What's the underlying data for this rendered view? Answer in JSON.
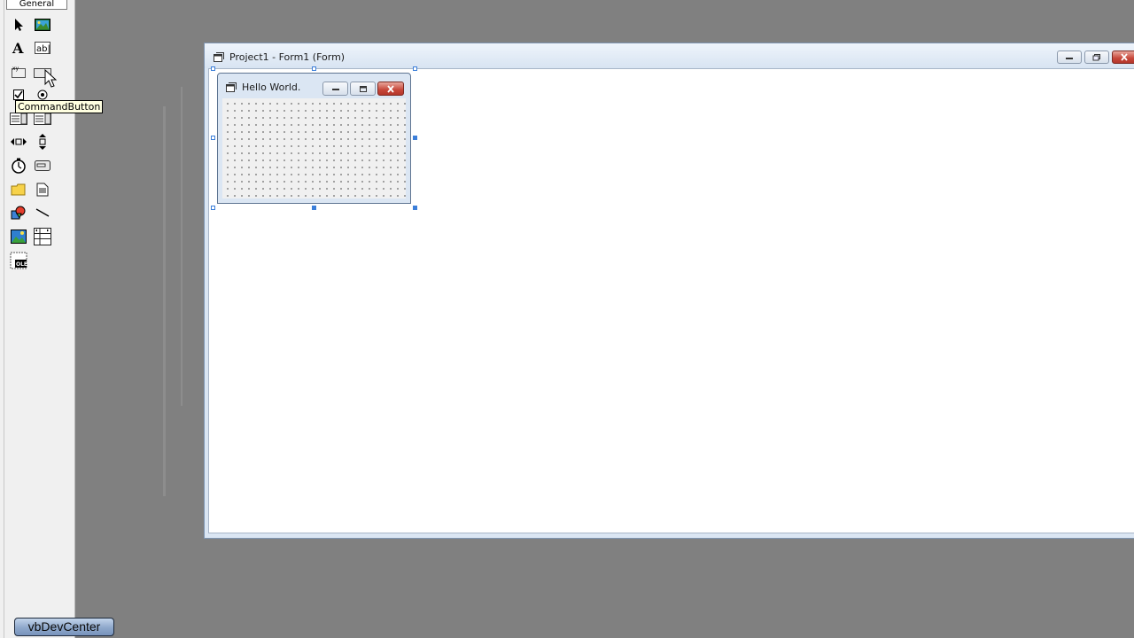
{
  "toolbox": {
    "tab_label": "General",
    "tooltip": "CommandButton",
    "tools": [
      {
        "name": "pointer-icon"
      },
      {
        "name": "picturebox-icon"
      },
      {
        "name": "label-icon"
      },
      {
        "name": "textbox-icon"
      },
      {
        "name": "frame-icon"
      },
      {
        "name": "commandbutton-icon"
      },
      {
        "name": "checkbox-icon"
      },
      {
        "name": "optionbutton-icon"
      },
      {
        "name": "combobox-icon"
      },
      {
        "name": "listbox-icon"
      },
      {
        "name": "hscrollbar-icon"
      },
      {
        "name": "vscrollbar-icon"
      },
      {
        "name": "timer-icon"
      },
      {
        "name": "drivelistbox-icon"
      },
      {
        "name": "dirlistbox-icon"
      },
      {
        "name": "filelistbox-icon"
      },
      {
        "name": "shape-icon"
      },
      {
        "name": "line-icon"
      },
      {
        "name": "image-icon"
      },
      {
        "name": "data-icon"
      },
      {
        "name": "ole-icon"
      }
    ]
  },
  "project_window": {
    "title": "Project1 - Form1 (Form)"
  },
  "form": {
    "caption": "Hello World."
  },
  "taskbar": {
    "badge_label": "vbDevCenter"
  },
  "colors": {
    "workspace": "#808080",
    "close_button": "#c7473a",
    "selection_handle": "#3c7fd9"
  }
}
